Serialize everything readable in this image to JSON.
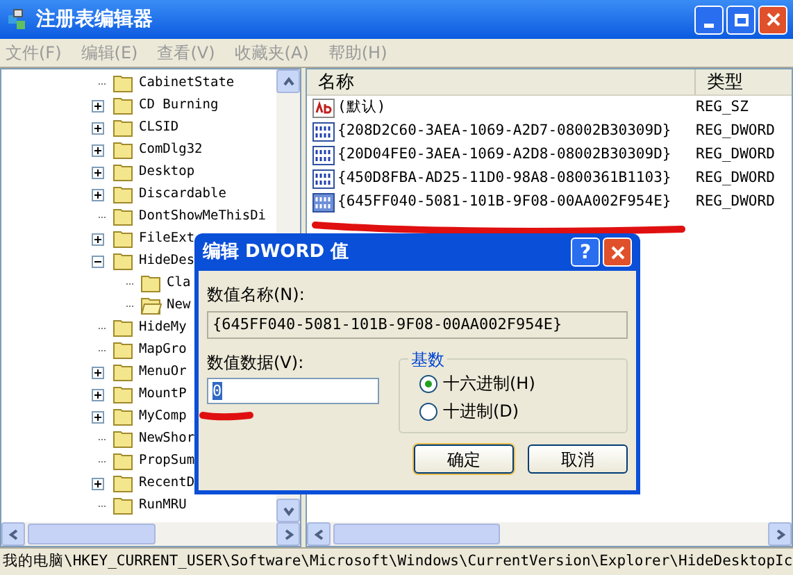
{
  "window": {
    "title": "注册表编辑器"
  },
  "menu": [
    "文件(F)",
    "编辑(E)",
    "查看(V)",
    "收藏夹(A)",
    "帮助(H)"
  ],
  "tree": [
    {
      "kind": "leaf",
      "label": "CabinetState"
    },
    {
      "kind": "collapsed",
      "label": "CD Burning"
    },
    {
      "kind": "collapsed",
      "label": "CLSID"
    },
    {
      "kind": "collapsed",
      "label": "ComDlg32"
    },
    {
      "kind": "collapsed",
      "label": "Desktop"
    },
    {
      "kind": "collapsed",
      "label": "Discardable"
    },
    {
      "kind": "leaf",
      "label": "DontShowMeThisDi"
    },
    {
      "kind": "collapsed",
      "label": "FileExt"
    },
    {
      "kind": "expanded",
      "label": "HideDes",
      "children": [
        {
          "kind": "leaf",
          "label": "Cla",
          "selected": false
        },
        {
          "kind": "leaf",
          "label": "New",
          "selected": true
        }
      ]
    },
    {
      "kind": "leaf",
      "label": "HideMy"
    },
    {
      "kind": "leaf",
      "label": "MapGro"
    },
    {
      "kind": "collapsed",
      "label": "MenuOr"
    },
    {
      "kind": "collapsed",
      "label": "MountP"
    },
    {
      "kind": "collapsed",
      "label": "MyComp"
    },
    {
      "kind": "leaf",
      "label": "NewShor"
    },
    {
      "kind": "leaf",
      "label": "PropSum"
    },
    {
      "kind": "collapsed",
      "label": "RecentD"
    },
    {
      "kind": "leaf",
      "label": "RunMRU"
    }
  ],
  "list": {
    "columns": [
      "名称",
      "类型"
    ],
    "rows": [
      {
        "kind": "string",
        "name": "(默认)",
        "type": "REG_SZ",
        "selected": false
      },
      {
        "kind": "dword",
        "name": "{208D2C60-3AEA-1069-A2D7-08002B30309D}",
        "type": "REG_DWORD",
        "selected": false
      },
      {
        "kind": "dword",
        "name": "{20D04FE0-3AEA-1069-A2D8-08002B30309D}",
        "type": "REG_DWORD",
        "selected": false
      },
      {
        "kind": "dword",
        "name": "{450D8FBA-AD25-11D0-98A8-0800361B1103}",
        "type": "REG_DWORD",
        "selected": false
      },
      {
        "kind": "dword",
        "name": "{645FF040-5081-101B-9F08-00AA002F954E}",
        "type": "REG_DWORD",
        "selected": true
      }
    ]
  },
  "status_bar": "我的电脑\\HKEY_CURRENT_USER\\Software\\Microsoft\\Windows\\CurrentVersion\\Explorer\\HideDesktopIc",
  "dialog": {
    "title": "编辑 DWORD 值",
    "help": "?",
    "name_label": "数值名称(N):",
    "name_value": "{645FF040-5081-101B-9F08-00AA002F954E}",
    "data_label": "数值数据(V):",
    "data_value": "0",
    "base_group": "基数",
    "bases": [
      {
        "label": "十六进制(H)",
        "selected": true
      },
      {
        "label": "十进制(D)",
        "selected": false
      }
    ],
    "buttons": [
      "确定",
      "取消"
    ]
  }
}
